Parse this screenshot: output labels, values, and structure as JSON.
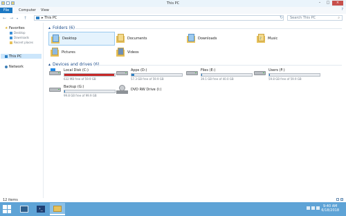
{
  "window": {
    "title": "This PC",
    "controls": {
      "minimize": "–",
      "maximize": "□",
      "close": "×"
    }
  },
  "ribbon": {
    "tabs": [
      "File",
      "Computer",
      "View"
    ],
    "help_icon": "?"
  },
  "address": {
    "path_root": "▸",
    "path": "This PC",
    "search_placeholder": "Search This PC",
    "icons": [
      "back-arrow-icon",
      "forward-arrow-icon",
      "up-arrow-icon",
      "refresh-icon",
      "search-icon"
    ]
  },
  "navpane": {
    "favorites_label": "Favorites",
    "favorites": [
      "Desktop",
      "Downloads",
      "Recent places"
    ],
    "thispc_label": "This PC",
    "network_label": "Network"
  },
  "folders": {
    "header": "Folders (6)",
    "items": [
      "Desktop",
      "Documents",
      "Downloads",
      "Music",
      "Pictures",
      "Videos"
    ]
  },
  "drives": {
    "header": "Devices and drives (6)",
    "items": [
      {
        "name": "Local Disk (C:)",
        "free": "632 MB free of 59.9 GB",
        "used_fraction": 0.99,
        "color": "#c62828"
      },
      {
        "name": "Apps (D:)",
        "free": "57.3 GB free of 59.9 GB",
        "used_fraction": 0.05,
        "color": "#2b7fc4"
      },
      {
        "name": "Files (E:)",
        "free": "39.1 GB free of 40.0 GB",
        "used_fraction": 0.02,
        "color": "#2b7fc4"
      },
      {
        "name": "Users (F:)",
        "free": "59.8 GB free of 59.9 GB",
        "used_fraction": 0.01,
        "color": "#2b7fc4"
      },
      {
        "name": "Backup (G:)",
        "free": "99.8 GB free of 99.9 GB",
        "used_fraction": 0.01,
        "color": "#2b7fc4"
      },
      {
        "name": "DVD RW Drive (I:)"
      }
    ]
  },
  "status": {
    "items_text": "12 items"
  },
  "taskbar": {
    "time": "9:40 AM",
    "date": "6/18/2018"
  }
}
